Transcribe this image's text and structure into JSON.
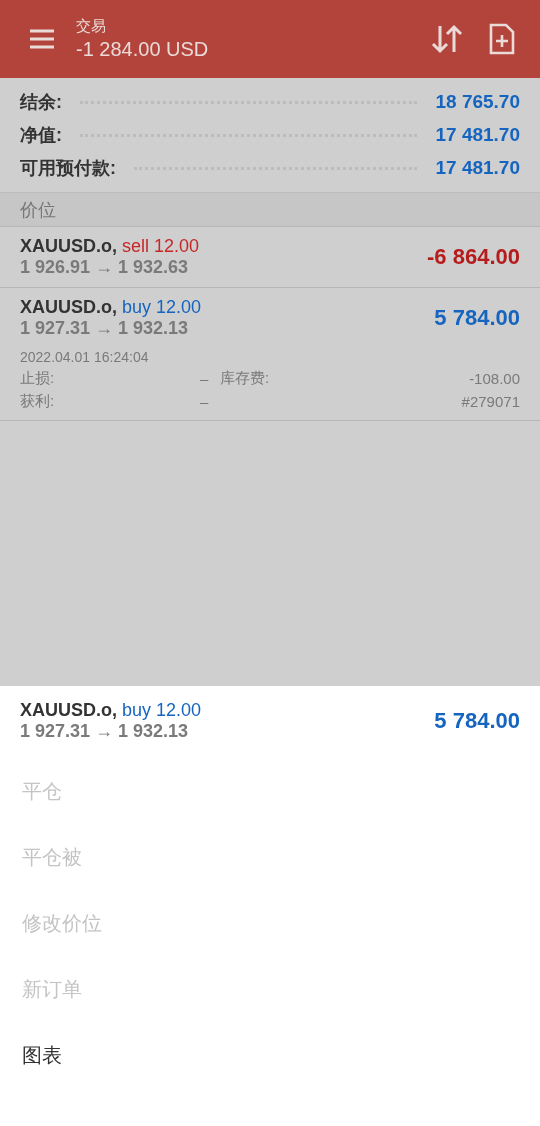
{
  "header": {
    "title": "交易",
    "subtitle": "-1 284.00 USD"
  },
  "summary": [
    {
      "label": "结余:",
      "value": "18 765.70"
    },
    {
      "label": "净值:",
      "value": "17 481.70"
    },
    {
      "label": "可用预付款:",
      "value": "17 481.70"
    }
  ],
  "section": "价位",
  "positions": [
    {
      "symbol": "XAUUSD.o,",
      "order": "sell 12.00",
      "color": "#c62828",
      "prices": "1 926.91 → 1 932.63",
      "profit": "-6 864.00"
    },
    {
      "symbol": "XAUUSD.o,",
      "order": "buy 12.00",
      "color": "#1565c0",
      "prices": "1 927.31 → 1 932.13",
      "profit": "5 784.00",
      "time": "2022.04.01 16:24:04",
      "details": [
        {
          "label": "止损:",
          "value": "–",
          "label_2": "库存费:",
          "value_2": "-108.00"
        },
        {
          "label": "获利:",
          "value": "–",
          "value_2": "#279071"
        }
      ]
    }
  ],
  "sheet": {
    "symbol": "XAUUSD.o,",
    "order": "buy 12.00",
    "color": "#1565c0",
    "prices": "1 927.31 → 1 932.13",
    "profit": "5 784.00",
    "menu": [
      {
        "label": "平仓",
        "disabled": true
      },
      {
        "label": "平仓被",
        "disabled": true
      },
      {
        "label": "修改价位",
        "disabled": true
      },
      {
        "label": "新订单",
        "disabled": true
      },
      {
        "label": "图表",
        "disabled": false
      }
    ]
  }
}
